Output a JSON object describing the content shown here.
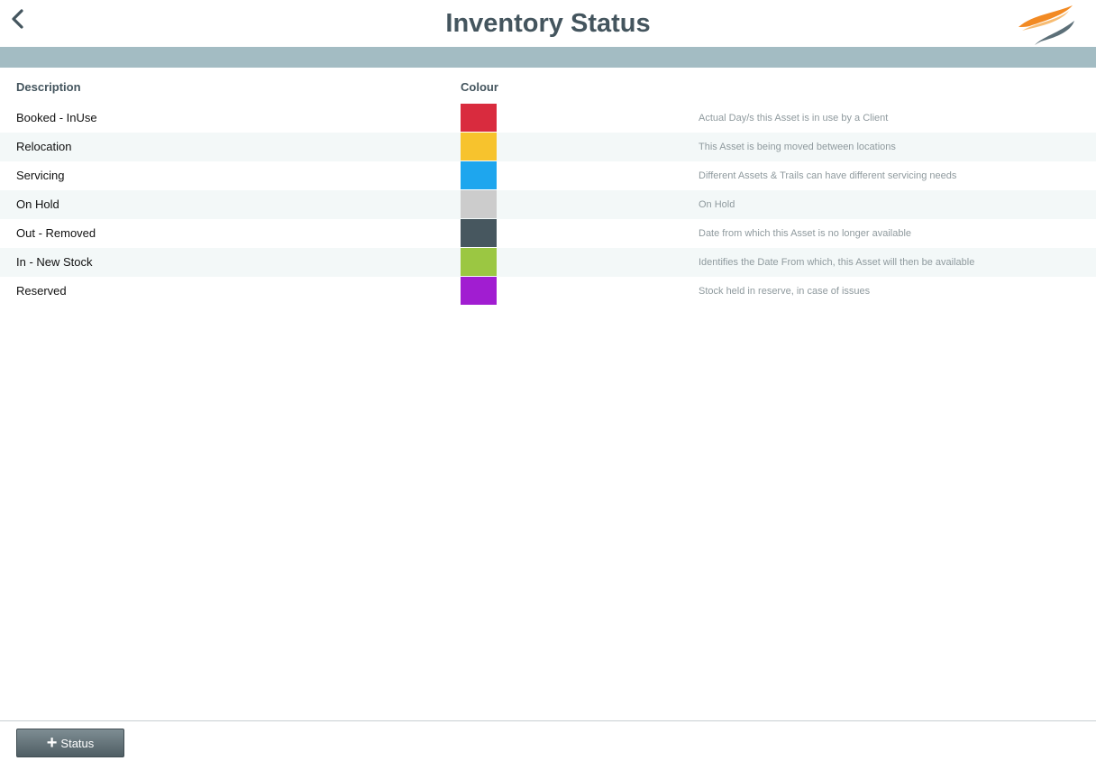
{
  "header": {
    "title": "Inventory Status",
    "back_icon": "chevron-left-icon",
    "logo_icon": "swoosh-logo-icon"
  },
  "table": {
    "headers": {
      "description": "Description",
      "colour": "Colour",
      "note": ""
    },
    "rows": [
      {
        "description": "Booked - InUse",
        "colour": "#d92b3e",
        "note": "Actual Day/s this Asset is in use by a Client"
      },
      {
        "description": "Relocation",
        "colour": "#f7c32d",
        "note": "This Asset is being moved between locations"
      },
      {
        "description": "Servicing",
        "colour": "#1ea6ee",
        "note": "Different Assets & Trails can have different servicing needs"
      },
      {
        "description": "On Hold",
        "colour": "#cccccc",
        "note": "On Hold"
      },
      {
        "description": "Out - Removed",
        "colour": "#47575f",
        "note": "Date from which this Asset is no longer available"
      },
      {
        "description": "In - New Stock",
        "colour": "#9bc742",
        "note": "Identifies the Date From which, this Asset will then be available"
      },
      {
        "description": "Reserved",
        "colour": "#a11dd1",
        "note": "Stock held in reserve, in case of issues"
      }
    ]
  },
  "footer": {
    "add_button_label": "Status",
    "add_icon": "plus-icon"
  },
  "colors": {
    "title": "#44555e",
    "band": "#a3bcc3",
    "alt_row": "#f3f8f8"
  }
}
